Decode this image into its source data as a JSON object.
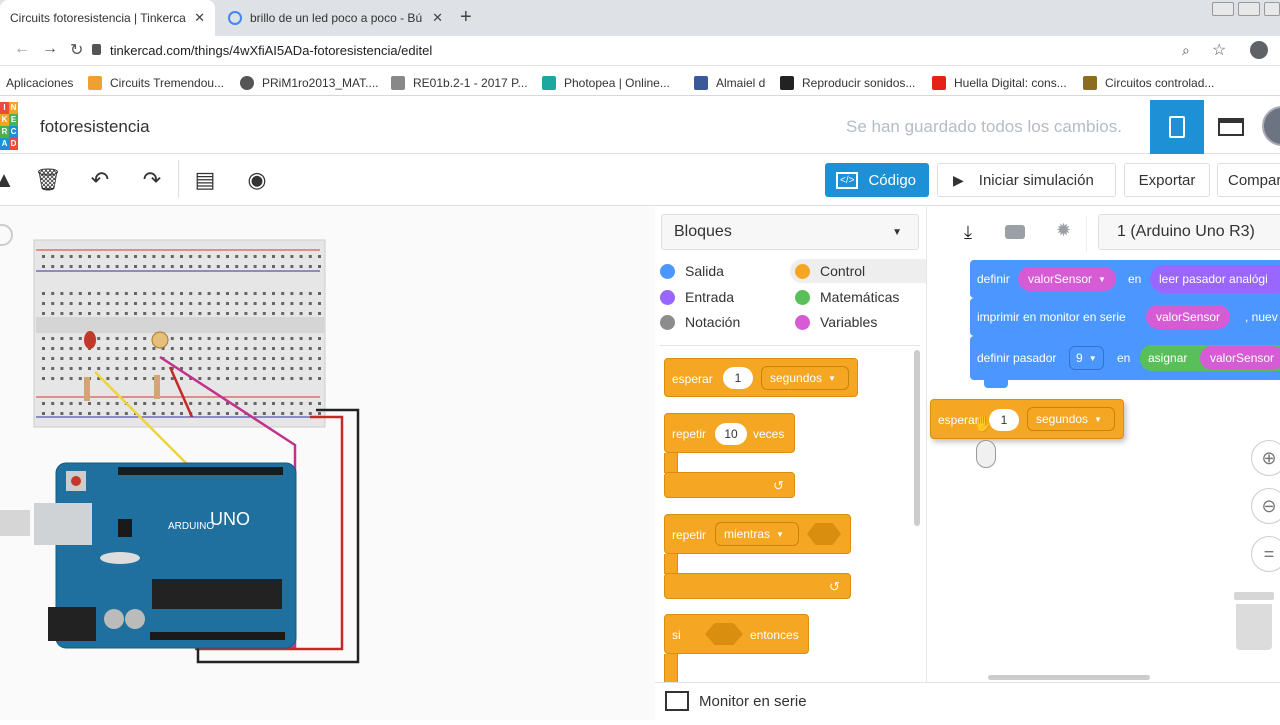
{
  "browser": {
    "tabs": [
      {
        "title": "Circuits fotoresistencia | Tinkerca",
        "active": true
      },
      {
        "title": "brillo de un led poco a poco - Bú",
        "active": false
      }
    ],
    "url": "tinkercad.com/things/4wXfiAI5ADa-fotoresistencia/editel",
    "bookmarks": [
      "Aplicaciones",
      "Circuits Tremendou...",
      "PRiM1ro2013_MAT....",
      "RE01b.2-1 - 2017 P...",
      "Photopea | Online...",
      "Almaiel d",
      "Reproducir sonidos...",
      "Huella Digital: cons...",
      "Circuitos controlad..."
    ]
  },
  "app": {
    "logo_letters": [
      "I",
      "N",
      "K",
      "E",
      "R",
      "C",
      "A",
      "D"
    ],
    "project_name": "fotoresistencia",
    "save_status": "Se han guardado todos los cambios."
  },
  "toolbar": {
    "code_label": "Código",
    "simulate_label": "Iniciar simulación",
    "export_label": "Exportar",
    "share_label": "Compar"
  },
  "blocks_panel": {
    "selector_label": "Bloques",
    "categories": [
      {
        "label": "Salida",
        "color": "#4c97ff"
      },
      {
        "label": "Control",
        "color": "#f5a623"
      },
      {
        "label": "Entrada",
        "color": "#9966ff"
      },
      {
        "label": "Matemáticas",
        "color": "#59c059"
      },
      {
        "label": "Notación",
        "color": "#8c8c8c"
      },
      {
        "label": "Variables",
        "color": "#d65cd6"
      }
    ],
    "palette": {
      "wait": {
        "label": "esperar",
        "value": "1",
        "unit": "segundos"
      },
      "repeat": {
        "label": "repetir",
        "value": "10",
        "suffix": "veces"
      },
      "repeat_while": {
        "label": "repetir",
        "mode": "mientras"
      },
      "if": {
        "label": "si",
        "suffix": "entonces"
      }
    }
  },
  "code_area": {
    "upload_icon": "download-icon",
    "board_label": "1 (Arduino Uno R3)",
    "program": {
      "define_label": "definir",
      "var_name": "valorSensor",
      "in_label": "en",
      "read_label": "leer pasador analógi",
      "print_label": "imprimir en monitor en serie",
      "print_var": "valorSensor",
      "print_suffix": ", nuev",
      "define_pin_label": "definir pasador",
      "pin_value": "9",
      "in_label2": "en",
      "map_label": "asignar",
      "map_var": "valorSensor"
    },
    "dragging": {
      "label": "esperar",
      "value": "1",
      "unit": "segundos"
    }
  },
  "serial_monitor_label": "Monitor en serie",
  "colors": {
    "tinkercad_blue": "#1e90d6",
    "control_orange": "#f5a623",
    "output_blue": "#4c97ff",
    "variable_magenta": "#d65cd6",
    "math_green": "#59c059"
  }
}
